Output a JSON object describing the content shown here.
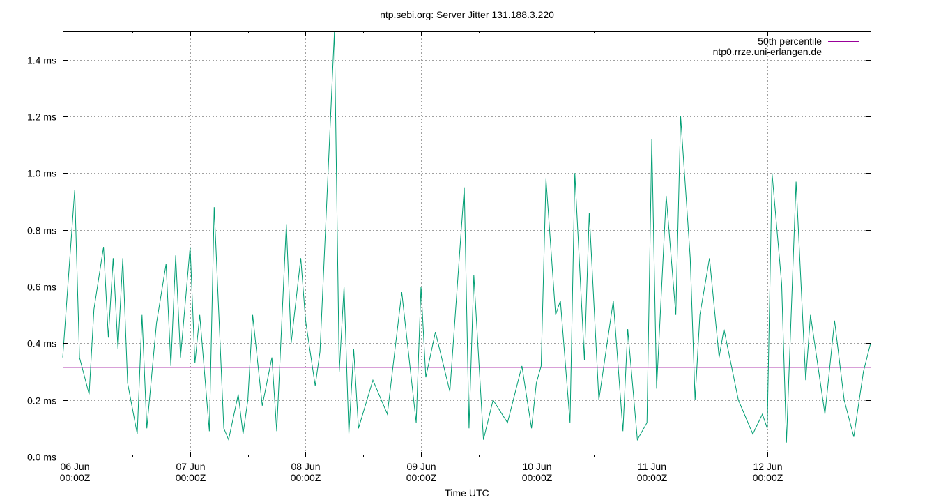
{
  "chart_data": {
    "type": "line",
    "title": "ntp.sebi.org: Server Jitter 131.188.3.220",
    "xlabel": "Time UTC",
    "ylabel": "",
    "ylim": [
      0,
      1.5
    ],
    "y_unit": "ms",
    "y_ticks": [
      {
        "value": 0.0,
        "label": "0.0 ms"
      },
      {
        "value": 0.2,
        "label": "0.2 ms"
      },
      {
        "value": 0.4,
        "label": "0.4 ms"
      },
      {
        "value": 0.6,
        "label": "0.6 ms"
      },
      {
        "value": 0.8,
        "label": "0.8 ms"
      },
      {
        "value": 1.0,
        "label": "1.0 ms"
      },
      {
        "value": 1.2,
        "label": "1.2 ms"
      },
      {
        "value": 1.4,
        "label": "1.4 ms"
      }
    ],
    "xlim": [
      "2024-06-05T21:30Z",
      "2024-06-12T21:30Z"
    ],
    "x_ticks": [
      {
        "value": "06 Jun 00:00Z",
        "line1": "06 Jun",
        "line2": "00:00Z"
      },
      {
        "value": "07 Jun 00:00Z",
        "line1": "07 Jun",
        "line2": "00:00Z"
      },
      {
        "value": "08 Jun 00:00Z",
        "line1": "08 Jun",
        "line2": "00:00Z"
      },
      {
        "value": "09 Jun 00:00Z",
        "line1": "09 Jun",
        "line2": "00:00Z"
      },
      {
        "value": "10 Jun 00:00Z",
        "line1": "10 Jun",
        "line2": "00:00Z"
      },
      {
        "value": "11 Jun 00:00Z",
        "line1": "11 Jun",
        "line2": "00:00Z"
      },
      {
        "value": "12 Jun 00:00Z",
        "line1": "12 Jun",
        "line2": "00:00Z"
      }
    ],
    "grid": true,
    "legend_position": "top-right",
    "series": [
      {
        "name": "50th percentile",
        "color": "#990099",
        "x": [
          "2024-06-05T21:30Z",
          "2024-06-12T21:30Z"
        ],
        "values": [
          0.315,
          0.315
        ]
      },
      {
        "name": "ntp0.rrze.uni-erlangen.de",
        "color": "#009e73",
        "x": [
          "2024-06-05T21:30Z",
          "2024-06-06T00:00Z",
          "2024-06-06T01:00Z",
          "2024-06-06T03:00Z",
          "2024-06-06T04:00Z",
          "2024-06-06T06:00Z",
          "2024-06-06T07:00Z",
          "2024-06-06T08:00Z",
          "2024-06-06T09:00Z",
          "2024-06-06T10:00Z",
          "2024-06-06T11:00Z",
          "2024-06-06T13:00Z",
          "2024-06-06T14:00Z",
          "2024-06-06T15:00Z",
          "2024-06-06T17:00Z",
          "2024-06-06T19:00Z",
          "2024-06-06T20:00Z",
          "2024-06-06T21:00Z",
          "2024-06-06T22:00Z",
          "2024-06-07T00:00Z",
          "2024-06-07T01:00Z",
          "2024-06-07T02:00Z",
          "2024-06-07T04:00Z",
          "2024-06-07T05:00Z",
          "2024-06-07T07:00Z",
          "2024-06-07T08:00Z",
          "2024-06-07T10:00Z",
          "2024-06-07T11:00Z",
          "2024-06-07T12:00Z",
          "2024-06-07T13:00Z",
          "2024-06-07T15:00Z",
          "2024-06-07T17:00Z",
          "2024-06-07T18:00Z",
          "2024-06-07T20:00Z",
          "2024-06-07T21:00Z",
          "2024-06-07T23:00Z",
          "2024-06-08T00:00Z",
          "2024-06-08T02:00Z",
          "2024-06-08T03:00Z",
          "2024-06-08T06:00Z",
          "2024-06-08T07:00Z",
          "2024-06-08T08:00Z",
          "2024-06-08T09:00Z",
          "2024-06-08T10:00Z",
          "2024-06-08T11:00Z",
          "2024-06-08T14:00Z",
          "2024-06-08T17:00Z",
          "2024-06-08T20:00Z",
          "2024-06-08T23:00Z",
          "2024-06-09T00:00Z",
          "2024-06-09T01:00Z",
          "2024-06-09T03:00Z",
          "2024-06-09T06:00Z",
          "2024-06-09T09:00Z",
          "2024-06-09T10:00Z",
          "2024-06-09T11:00Z",
          "2024-06-09T13:00Z",
          "2024-06-09T15:00Z",
          "2024-06-09T18:00Z",
          "2024-06-09T21:00Z",
          "2024-06-09T23:00Z",
          "2024-06-10T00:00Z",
          "2024-06-10T01:00Z",
          "2024-06-10T02:00Z",
          "2024-06-10T04:00Z",
          "2024-06-10T05:00Z",
          "2024-06-10T07:00Z",
          "2024-06-10T08:00Z",
          "2024-06-10T10:00Z",
          "2024-06-10T11:00Z",
          "2024-06-10T13:00Z",
          "2024-06-10T16:00Z",
          "2024-06-10T18:00Z",
          "2024-06-10T19:00Z",
          "2024-06-10T21:00Z",
          "2024-06-10T23:00Z",
          "2024-06-11T00:00Z",
          "2024-06-11T01:00Z",
          "2024-06-11T03:00Z",
          "2024-06-11T05:00Z",
          "2024-06-11T06:00Z",
          "2024-06-11T08:00Z",
          "2024-06-11T09:00Z",
          "2024-06-11T10:00Z",
          "2024-06-11T12:00Z",
          "2024-06-11T14:00Z",
          "2024-06-11T15:00Z",
          "2024-06-11T18:00Z",
          "2024-06-11T21:00Z",
          "2024-06-11T23:00Z",
          "2024-06-12T00:00Z",
          "2024-06-12T01:00Z",
          "2024-06-12T03:00Z",
          "2024-06-12T04:00Z",
          "2024-06-12T06:00Z",
          "2024-06-12T08:00Z",
          "2024-06-12T09:00Z",
          "2024-06-12T12:00Z",
          "2024-06-12T14:00Z",
          "2024-06-12T16:00Z",
          "2024-06-12T18:00Z",
          "2024-06-12T20:00Z",
          "2024-06-12T21:30Z"
        ],
        "values": [
          0.35,
          0.94,
          0.35,
          0.22,
          0.52,
          0.74,
          0.42,
          0.7,
          0.38,
          0.7,
          0.26,
          0.08,
          0.5,
          0.1,
          0.47,
          0.68,
          0.32,
          0.71,
          0.35,
          0.74,
          0.33,
          0.5,
          0.09,
          0.88,
          0.1,
          0.06,
          0.22,
          0.08,
          0.2,
          0.5,
          0.18,
          0.35,
          0.09,
          0.82,
          0.4,
          0.7,
          0.48,
          0.25,
          0.37,
          1.5,
          0.3,
          0.6,
          0.08,
          0.38,
          0.1,
          0.27,
          0.15,
          0.58,
          0.12,
          0.6,
          0.28,
          0.44,
          0.23,
          0.95,
          0.1,
          0.64,
          0.06,
          0.2,
          0.12,
          0.32,
          0.1,
          0.26,
          0.32,
          0.98,
          0.5,
          0.55,
          0.12,
          1.0,
          0.34,
          0.86,
          0.2,
          0.55,
          0.09,
          0.45,
          0.06,
          0.12,
          1.12,
          0.24,
          0.92,
          0.5,
          1.2,
          0.7,
          0.2,
          0.5,
          0.7,
          0.35,
          0.45,
          0.2,
          0.08,
          0.15,
          0.1,
          1.0,
          0.61,
          0.05,
          0.97,
          0.27,
          0.5,
          0.15,
          0.48,
          0.2,
          0.07,
          0.3,
          0.4
        ]
      }
    ]
  }
}
